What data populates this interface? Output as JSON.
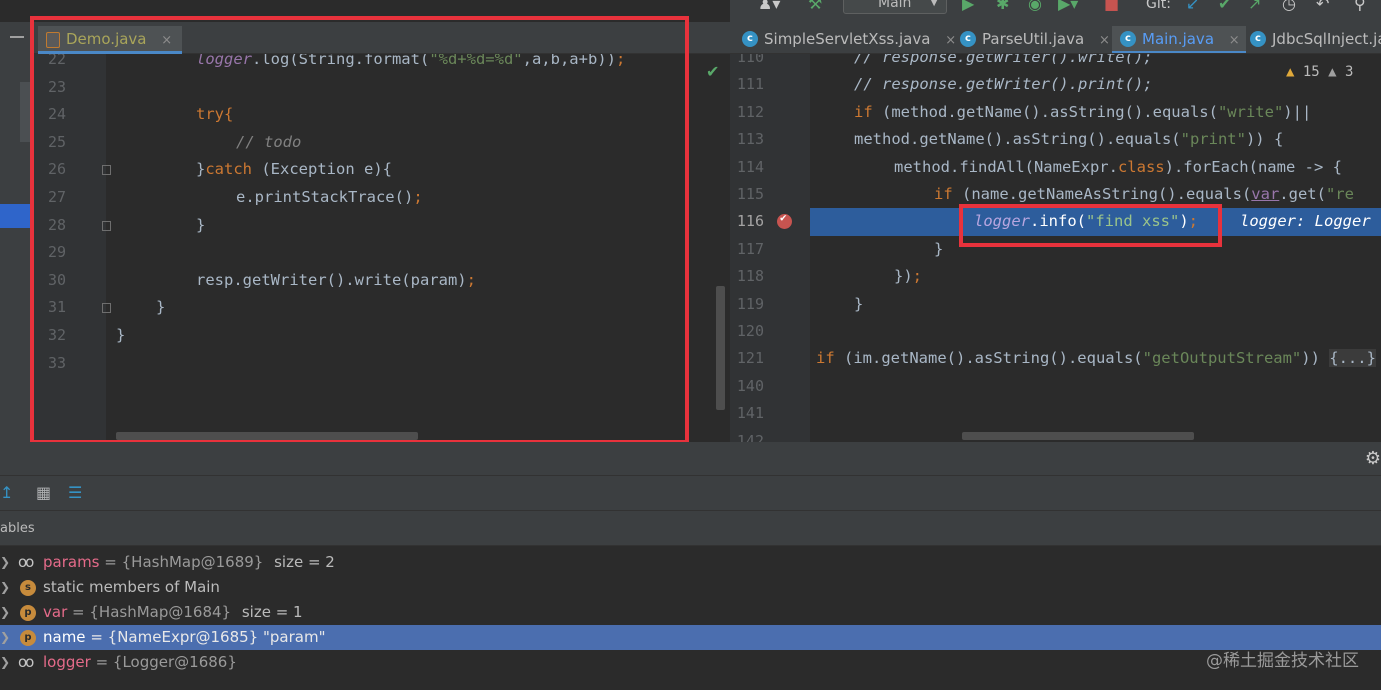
{
  "toolbar": {
    "run_config": "Main",
    "git_label": "Git:"
  },
  "left_editor": {
    "tab": {
      "label": "Demo.java",
      "close": "×"
    },
    "lines": [
      {
        "num": "22",
        "code": "logger.log(String.format(\"%d+%d=%d\",a,b,a+b));"
      },
      {
        "num": "23",
        "code": ""
      },
      {
        "num": "24",
        "code": "try{"
      },
      {
        "num": "25",
        "code": "// todo"
      },
      {
        "num": "26",
        "code": "}catch (Exception e){"
      },
      {
        "num": "27",
        "code": "e.printStackTrace();"
      },
      {
        "num": "28",
        "code": "}"
      },
      {
        "num": "29",
        "code": ""
      },
      {
        "num": "30",
        "code": "resp.getWriter().write(param);"
      },
      {
        "num": "31",
        "code": "}"
      },
      {
        "num": "32",
        "code": "}"
      },
      {
        "num": "33",
        "code": ""
      }
    ]
  },
  "right_editor": {
    "tabs": [
      {
        "label": "SimpleServletXss.java",
        "close": "×"
      },
      {
        "label": "ParseUtil.java",
        "close": "×"
      },
      {
        "label": "Main.java",
        "close": "×",
        "active": true
      },
      {
        "label": "JdbcSqlInject.java",
        "close": ""
      }
    ],
    "inspections": {
      "warnings": "15",
      "weak_warnings": "3"
    },
    "lines": [
      {
        "num": "110",
        "code": "// response.getWriter().write();"
      },
      {
        "num": "111",
        "code": "// response.getWriter().print();"
      },
      {
        "num": "112",
        "code": "if (method.getName().asString().equals(\"write\")||"
      },
      {
        "num": "113",
        "code": "method.getName().asString().equals(\"print\")) {"
      },
      {
        "num": "114",
        "code": "method.findAll(NameExpr.class).forEach(name -> {"
      },
      {
        "num": "115",
        "code": "if (name.getNameAsString().equals(var.get(\"re"
      },
      {
        "num": "116",
        "code": "logger.info(\"find xss\");",
        "hint": "logger: Logger"
      },
      {
        "num": "117",
        "code": "}"
      },
      {
        "num": "118",
        "code": "});"
      },
      {
        "num": "119",
        "code": "}"
      },
      {
        "num": "120",
        "code": ""
      },
      {
        "num": "121",
        "code": "if (im.getName().asString().equals(\"getOutputStream\")) {...}"
      },
      {
        "num": "140",
        "code": ""
      },
      {
        "num": "141",
        "code": ""
      },
      {
        "num": "142",
        "code": ""
      }
    ]
  },
  "debug": {
    "variables_title": "ables",
    "variables": [
      {
        "name": "params",
        "value": "= {HashMap@1689}",
        "extra": "size = 2",
        "icon": "watch-glasses-icon",
        "selected": false
      },
      {
        "name": "",
        "value": "",
        "extra": "static members of Main",
        "icon": "static-field-icon",
        "selected": false
      },
      {
        "name": "var",
        "value": "= {HashMap@1684}",
        "extra": "size = 1",
        "icon": "parameter-icon",
        "selected": false
      },
      {
        "name": "name",
        "value": "= {NameExpr@1685} \"param\"",
        "extra": "",
        "icon": "parameter-icon",
        "selected": true
      },
      {
        "name": "logger",
        "value": "= {Logger@1686}",
        "extra": "",
        "icon": "watch-glasses-icon",
        "selected": false
      }
    ],
    "watermark": "@稀土掘金技术社区"
  },
  "colors": {
    "highlight_box": "#e8323c",
    "execution_line": "#2d5d9c",
    "selected_row": "#4b6eaf"
  }
}
